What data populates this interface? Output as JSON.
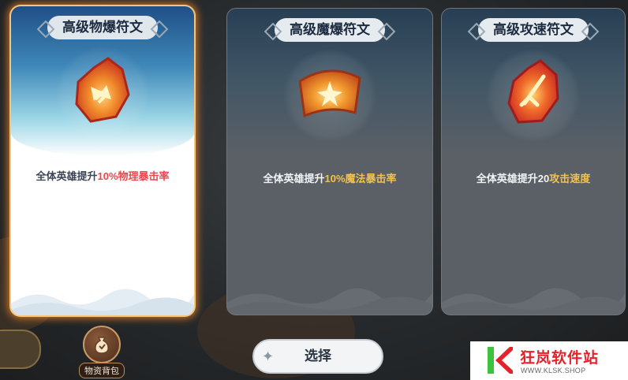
{
  "cards": [
    {
      "title": "高级物爆符文",
      "desc_prefix": "全体英雄提升",
      "desc_highlight": "10%物理暴击率",
      "selected": true,
      "rune_icon": "physical-crit-rune-icon"
    },
    {
      "title": "高级魔爆符文",
      "desc_prefix": "全体英雄提升",
      "desc_highlight": "10%魔法暴击率",
      "selected": false,
      "rune_icon": "magic-crit-rune-icon"
    },
    {
      "title": "高级攻速符文",
      "desc_prefix": "全体英雄提升20",
      "desc_highlight": "攻击速度",
      "selected": false,
      "rune_icon": "attack-speed-rune-icon"
    }
  ],
  "inventory_label": "物资背包",
  "select_button_label": "选择",
  "watermark": {
    "name": "狂岚软件站",
    "url": "WWW.KLSK.SHOP"
  },
  "colors": {
    "selected_glow": "#ff8c28",
    "highlight_red": "#e8484e",
    "highlight_gold": "#f4c04a",
    "watermark_red": "#e5212b",
    "watermark_green": "#3cc23c"
  }
}
